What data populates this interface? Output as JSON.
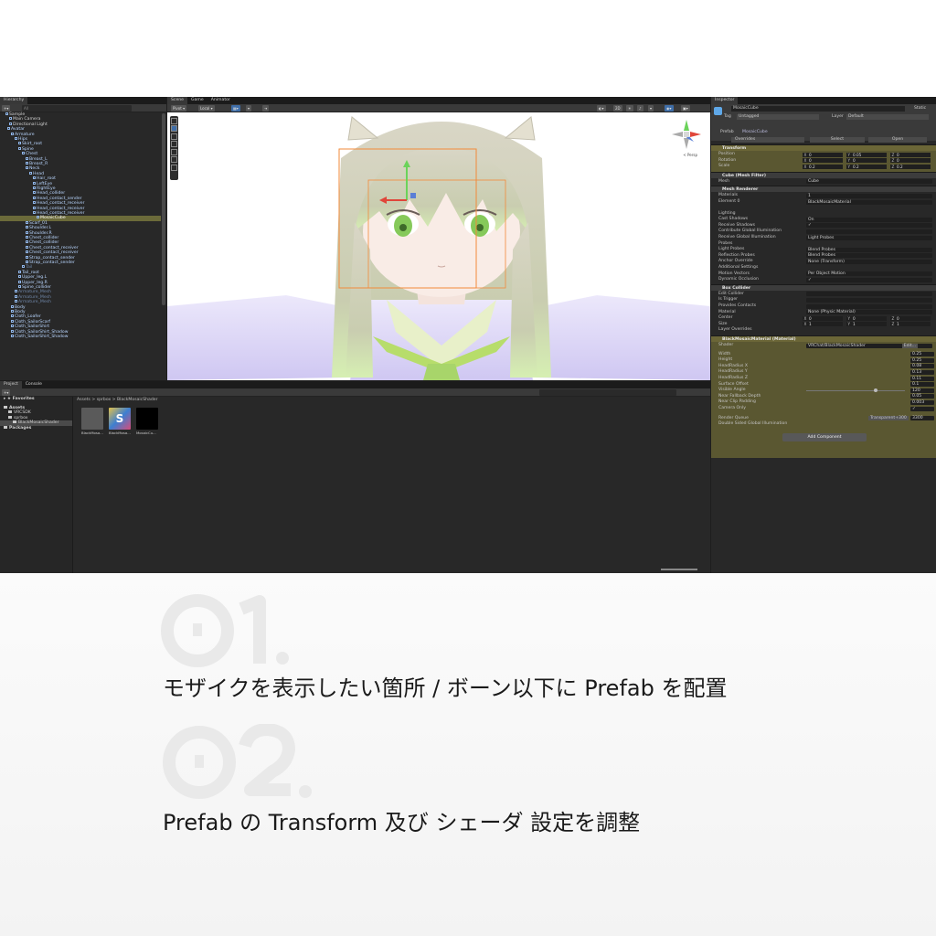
{
  "hierarchy": {
    "tab": "Hierarchy",
    "search_placeholder": "All",
    "rows": [
      {
        "label": "Sample",
        "indent": 3,
        "style": "plain"
      },
      {
        "label": "Main Camera",
        "indent": 5,
        "style": "plain"
      },
      {
        "label": "Directional Light",
        "indent": 5,
        "style": "plain"
      },
      {
        "label": "Avatar",
        "indent": 4,
        "style": ""
      },
      {
        "label": "Armature",
        "indent": 6,
        "style": ""
      },
      {
        "label": "Hips",
        "indent": 8,
        "style": ""
      },
      {
        "label": "Skirt_root",
        "indent": 10,
        "style": ""
      },
      {
        "label": "Spine",
        "indent": 10,
        "style": ""
      },
      {
        "label": "Chest",
        "indent": 12,
        "style": ""
      },
      {
        "label": "Breast_L",
        "indent": 14,
        "style": ""
      },
      {
        "label": "Breast_R",
        "indent": 14,
        "style": ""
      },
      {
        "label": "Neck",
        "indent": 14,
        "style": ""
      },
      {
        "label": "Head",
        "indent": 16,
        "style": ""
      },
      {
        "label": "Hair_root",
        "indent": 18,
        "style": ""
      },
      {
        "label": "LeftEye",
        "indent": 18,
        "style": ""
      },
      {
        "label": "RightEye",
        "indent": 18,
        "style": ""
      },
      {
        "label": "Head_collider",
        "indent": 18,
        "style": ""
      },
      {
        "label": "Head_contact_sender",
        "indent": 18,
        "style": ""
      },
      {
        "label": "Head_contact_receiver",
        "indent": 18,
        "style": ""
      },
      {
        "label": "Head_contact_receiver",
        "indent": 18,
        "style": ""
      },
      {
        "label": "Head_contact_receiver",
        "indent": 18,
        "style": ""
      },
      {
        "label": "MosaicCube",
        "indent": 20,
        "style": "sel"
      },
      {
        "label": "Scarf_01",
        "indent": 14,
        "style": ""
      },
      {
        "label": "Shoulder.L",
        "indent": 14,
        "style": ""
      },
      {
        "label": "Shoulder.R",
        "indent": 14,
        "style": ""
      },
      {
        "label": "Chest_collider",
        "indent": 14,
        "style": ""
      },
      {
        "label": "Chest_collider",
        "indent": 14,
        "style": ""
      },
      {
        "label": "Chest_contact_receiver",
        "indent": 14,
        "style": ""
      },
      {
        "label": "Chest_contact_receiver",
        "indent": 14,
        "style": ""
      },
      {
        "label": "Strap_contact_sender",
        "indent": 14,
        "style": ""
      },
      {
        "label": "Strap_contact_sender",
        "indent": 14,
        "style": ""
      },
      {
        "label": "Tail",
        "indent": 12,
        "style": "dim"
      },
      {
        "label": "Tail_root",
        "indent": 10,
        "style": ""
      },
      {
        "label": "Upper_leg.L",
        "indent": 10,
        "style": ""
      },
      {
        "label": "Upper_leg.R",
        "indent": 10,
        "style": ""
      },
      {
        "label": "Spine_collider",
        "indent": 10,
        "style": ""
      },
      {
        "label": "Armature_Mesh",
        "indent": 8,
        "style": "dim"
      },
      {
        "label": "Armature_Mesh",
        "indent": 8,
        "style": "dim"
      },
      {
        "label": "Armature_Mesh",
        "indent": 8,
        "style": "dim"
      },
      {
        "label": "Body",
        "indent": 6,
        "style": ""
      },
      {
        "label": "Body",
        "indent": 6,
        "style": ""
      },
      {
        "label": "Cloth_Loafer",
        "indent": 6,
        "style": ""
      },
      {
        "label": "Cloth_SailorScarf",
        "indent": 6,
        "style": ""
      },
      {
        "label": "Cloth_SailorShirt",
        "indent": 6,
        "style": ""
      },
      {
        "label": "Cloth_SailorShirt_Shadow",
        "indent": 6,
        "style": ""
      },
      {
        "label": "Cloth_SailorShirt_Shadow",
        "indent": 6,
        "style": ""
      }
    ]
  },
  "scene": {
    "tabs": [
      "Scene",
      "Game",
      "Animator"
    ],
    "pivot": "Pivot",
    "local": "Local",
    "twoD": "2D",
    "persp": "< Persp"
  },
  "inspector": {
    "tab": "Inspector",
    "object_name": "MosaicCube",
    "static": "Static",
    "tag_label": "Tag",
    "tag": "Untagged",
    "layer_label": "Layer",
    "layer": "Default",
    "prefab_label": "Prefab",
    "prefab_value": "MosaicCube",
    "overrides": "Overrides",
    "select": "Select",
    "open": "Open",
    "transform": {
      "title": "Transform",
      "rows": [
        {
          "label": "Position",
          "x": "0",
          "y": "0.05",
          "z": "0"
        },
        {
          "label": "Rotation",
          "x": "0",
          "y": "0",
          "z": "0"
        },
        {
          "label": "Scale",
          "x": "0.2",
          "y": "0.2",
          "z": "0.2"
        }
      ]
    },
    "mesh_filter": {
      "title": "Cube (Mesh Filter)",
      "mesh_label": "Mesh",
      "mesh": "Cube"
    },
    "mesh_renderer": {
      "title": "Mesh Renderer",
      "materials_label": "Materials",
      "materials_count": "1",
      "element0_label": "Element 0",
      "element0": "BlackMosaicMaterial",
      "lighting": "Lighting",
      "rows": [
        {
          "label": "Cast Shadows",
          "value": "On"
        },
        {
          "label": "Receive Shadows",
          "value": "✓"
        },
        {
          "label": "Contribute Global Illumination",
          "value": ""
        },
        {
          "label": "Receive Global Illumination",
          "value": "Light Probes"
        }
      ],
      "probes": "Probes",
      "probe_rows": [
        {
          "label": "Light Probes",
          "value": "Blend Probes"
        },
        {
          "label": "Reflection Probes",
          "value": "Blend Probes"
        },
        {
          "label": "Anchor Override",
          "value": "None (Transform)"
        }
      ],
      "additional": "Additional Settings",
      "add_rows": [
        {
          "label": "Motion Vectors",
          "value": "Per Object Motion"
        },
        {
          "label": "Dynamic Occlusion",
          "value": "✓"
        }
      ]
    },
    "box_collider": {
      "title": "Box Collider",
      "rows": [
        {
          "label": "Edit Collider",
          "value": ""
        },
        {
          "label": "Is Trigger",
          "value": ""
        },
        {
          "label": "Provides Contacts",
          "value": ""
        },
        {
          "label": "Material",
          "value": "None (Physic Material)"
        }
      ],
      "center": {
        "label": "Center",
        "x": "0",
        "y": "0",
        "z": "0"
      },
      "size": {
        "label": "Size",
        "x": "1",
        "y": "1",
        "z": "1"
      },
      "layer_overrides": "Layer Overrides"
    },
    "material": {
      "title": "BlackMosaicMaterial (Material)",
      "shader_label": "Shader",
      "shader": "VRChat/BlackMosaicShader",
      "edit": "Edit...",
      "props": [
        {
          "label": "Width",
          "value": "0.25"
        },
        {
          "label": "Height",
          "value": "0.25"
        },
        {
          "label": "HeadRadius X",
          "value": "0.08"
        },
        {
          "label": "HeadRadius Y",
          "value": "0.13"
        },
        {
          "label": "HeadRadius Z",
          "value": "0.11"
        },
        {
          "label": "Surface Offset",
          "value": "0.1"
        },
        {
          "label": "Visible Angle",
          "value": "120"
        },
        {
          "label": "Near Fallback Depth",
          "value": "0.05"
        },
        {
          "label": "Near Clip Padding",
          "value": "0.003"
        },
        {
          "label": "Camera Only",
          "value": "✓"
        }
      ],
      "render_queue_label": "Render Queue",
      "render_queue_mode": "Transparent+300",
      "render_queue": "3300",
      "double_sided": "Double Sided Global Illumination"
    },
    "add_component": "Add Component"
  },
  "project": {
    "tabs": [
      "Project",
      "Console"
    ],
    "favorites": "Favorites",
    "tree": [
      {
        "label": "Assets",
        "bold": true,
        "indent": 0
      },
      {
        "label": "VRCSDK",
        "bold": false,
        "indent": 1
      },
      {
        "label": "sprbox",
        "bold": false,
        "indent": 1
      },
      {
        "label": "BlackMosaicShader",
        "bold": false,
        "indent": 2,
        "sel": true
      },
      {
        "label": "Packages",
        "bold": true,
        "indent": 0
      }
    ],
    "breadcrumb": "Assets > sprbox > BlackMosaicShader",
    "assets": [
      {
        "name": "BlackMosa...",
        "color": "#5a5a5a"
      },
      {
        "name": "BlackMosa...",
        "color": "#3d7fd1"
      },
      {
        "name": "MosaicCu...",
        "color": "#000000"
      }
    ]
  },
  "steps": [
    {
      "number": "01.",
      "text": "モザイクを表示したい箇所 / ボーン以下に Prefab を配置"
    },
    {
      "number": "02.",
      "text": "Prefab の Transform 及び シェーダ 設定を調整"
    }
  ]
}
